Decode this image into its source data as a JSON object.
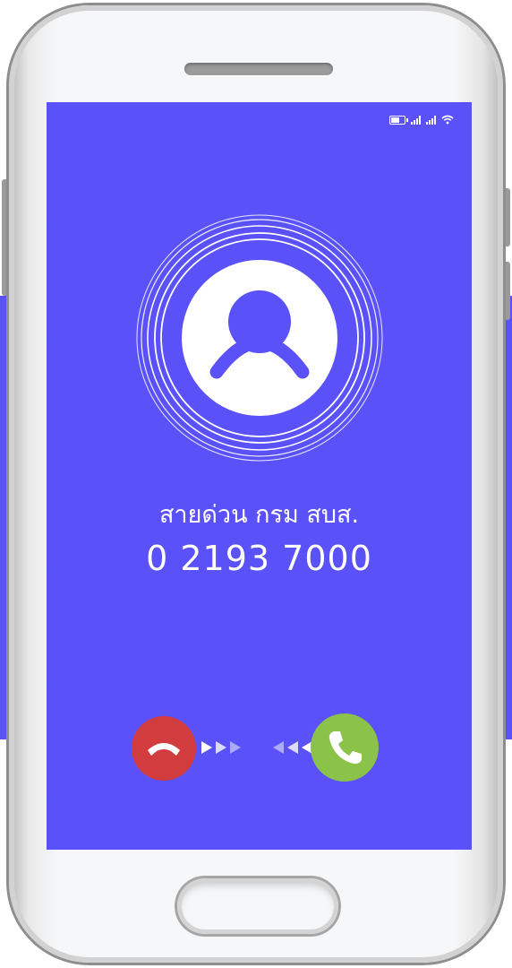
{
  "status_bar": {
    "battery_icon": "battery-icon",
    "signal_icons": [
      "signal-icon",
      "signal-icon"
    ],
    "wifi_icon": "wifi-icon"
  },
  "caller": {
    "name": "สายด่วน กรม สบส.",
    "number": "0 2193 7000",
    "avatar_icon": "user-avatar-icon"
  },
  "actions": {
    "decline_icon": "hang-up-icon",
    "accept_icon": "phone-icon"
  },
  "colors": {
    "screen": "#5a52f8",
    "decline": "#d33c3f",
    "accept": "#8bc34a",
    "text": "#ffffff"
  }
}
